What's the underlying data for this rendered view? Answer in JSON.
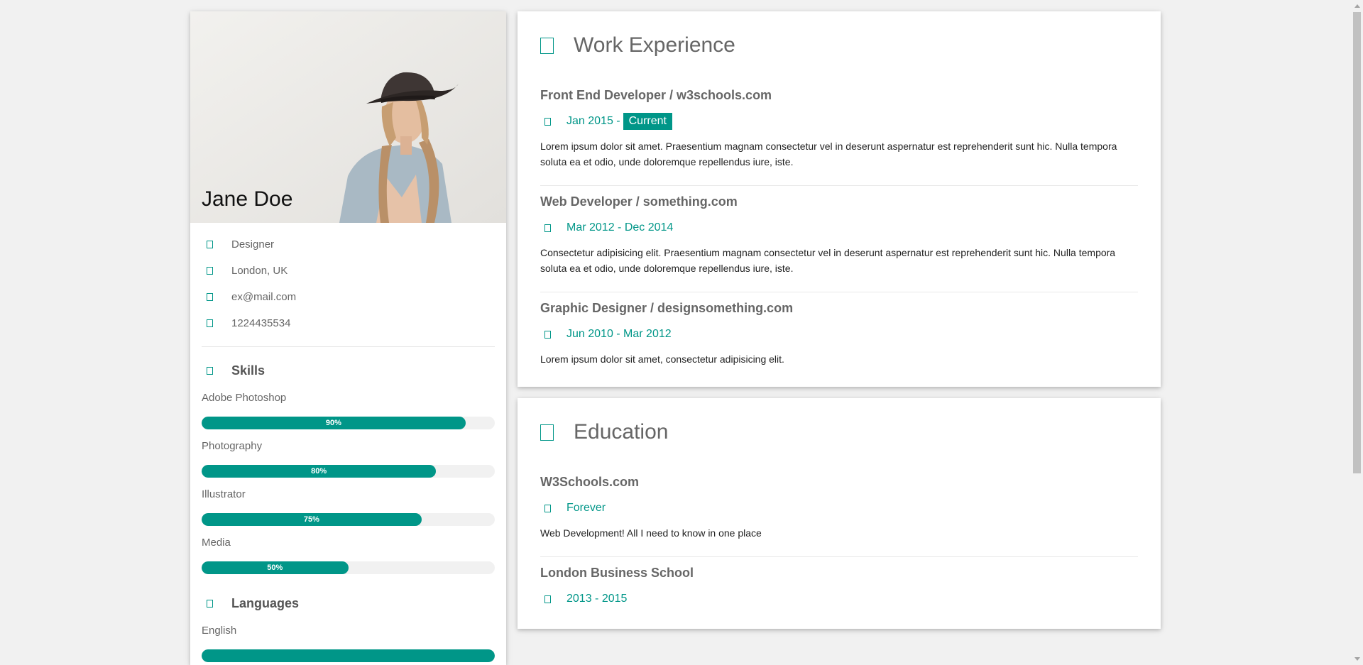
{
  "profile": {
    "name": "Jane Doe",
    "info": [
      {
        "icon": "briefcase-icon",
        "text": "Designer"
      },
      {
        "icon": "home-icon",
        "text": "London, UK"
      },
      {
        "icon": "envelope-icon",
        "text": "ex@mail.com"
      },
      {
        "icon": "phone-icon",
        "text": "1224435534"
      }
    ]
  },
  "skills": {
    "heading": "Skills",
    "items": [
      {
        "label": "Adobe Photoshop",
        "percent": 90,
        "text": "90%"
      },
      {
        "label": "Photography",
        "percent": 80,
        "text": "80%"
      },
      {
        "label": "Illustrator",
        "percent": 75,
        "text": "75%"
      },
      {
        "label": "Media",
        "percent": 50,
        "text": "50%"
      }
    ]
  },
  "languages": {
    "heading": "Languages",
    "items": [
      {
        "label": "English",
        "percent": 100
      }
    ]
  },
  "work": {
    "heading": "Work Experience",
    "entries": [
      {
        "title": "Front End Developer / w3schools.com",
        "date": "Jan 2015 -",
        "tag": "Current",
        "text": "Lorem ipsum dolor sit amet. Praesentium magnam consectetur vel in deserunt aspernatur est reprehenderit sunt hic. Nulla tempora soluta ea et odio, unde doloremque repellendus iure, iste."
      },
      {
        "title": "Web Developer / something.com",
        "date": "Mar 2012 - Dec 2014",
        "text": "Consectetur adipisicing elit. Praesentium magnam consectetur vel in deserunt aspernatur est reprehenderit sunt hic. Nulla tempora soluta ea et odio, unde doloremque repellendus iure, iste."
      },
      {
        "title": "Graphic Designer / designsomething.com",
        "date": "Jun 2010 - Mar 2012",
        "text": "Lorem ipsum dolor sit amet, consectetur adipisicing elit."
      }
    ]
  },
  "education": {
    "heading": "Education",
    "entries": [
      {
        "title": "W3Schools.com",
        "date": "Forever",
        "text": "Web Development! All I need to know in one place"
      },
      {
        "title": "London Business School",
        "date": "2013 - 2015",
        "text": ""
      }
    ]
  },
  "colors": {
    "accent": "#009688",
    "background": "#f1f1f1"
  }
}
